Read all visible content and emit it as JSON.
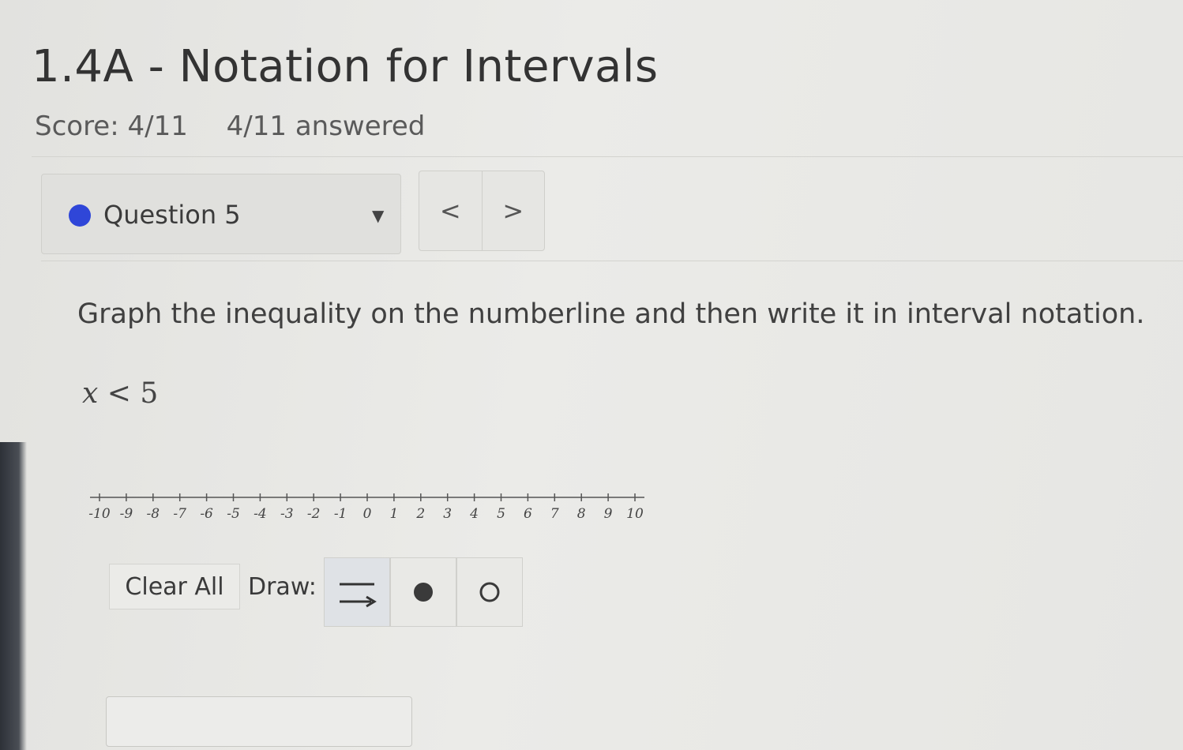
{
  "header": {
    "title": "1.4A - Notation for Intervals",
    "score": "Score: 4/11",
    "answered": "4/11 answered"
  },
  "question_nav": {
    "selected": "Question 5",
    "dot_color": "#2f46d8",
    "prev_label": "<",
    "next_label": ">"
  },
  "problem": {
    "prompt": "Graph the inequality on the numberline and then write it in interval notation.",
    "inequality_var": "x",
    "inequality_rest": " < 5"
  },
  "numberline": {
    "min": -10,
    "max": 10,
    "tick_labels": [
      "-10",
      "-9",
      "-8",
      "-7",
      "-6",
      "-5",
      "-4",
      "-3",
      "-2",
      "-1",
      "0",
      "1",
      "2",
      "3",
      "4",
      "5",
      "6",
      "7",
      "8",
      "9",
      "10"
    ]
  },
  "toolbar": {
    "clear_label": "Clear All",
    "draw_label": "Draw:",
    "tools": [
      "ray-tool-icon",
      "closed-dot-icon",
      "open-dot-icon"
    ]
  },
  "answer": {
    "value": ""
  }
}
